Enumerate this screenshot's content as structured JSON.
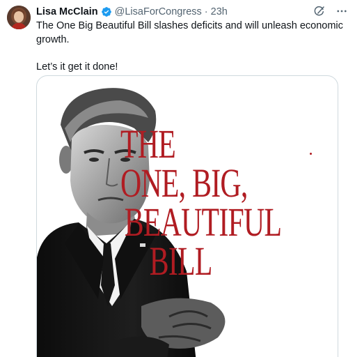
{
  "tweet": {
    "author_name": "Lisa McClain",
    "handle": "@LisaForCongress",
    "separator": "·",
    "time": "23h",
    "text_line_1": "The One Big Beautiful Bill slashes deficits and will unleash economic growth.",
    "text_line_2": "Let’s it get it done!"
  },
  "media": {
    "headline_lines": [
      "THE",
      "ONE, BIG,",
      "BEAUTIFUL",
      "BILL"
    ]
  },
  "icons": {
    "verified": "verified-badge-icon",
    "grok": "grok-icon",
    "more": "more-icon"
  },
  "colors": {
    "verified_blue": "#1d9bf0",
    "headline_red": "#b01c22",
    "secondary_text": "#536471"
  }
}
